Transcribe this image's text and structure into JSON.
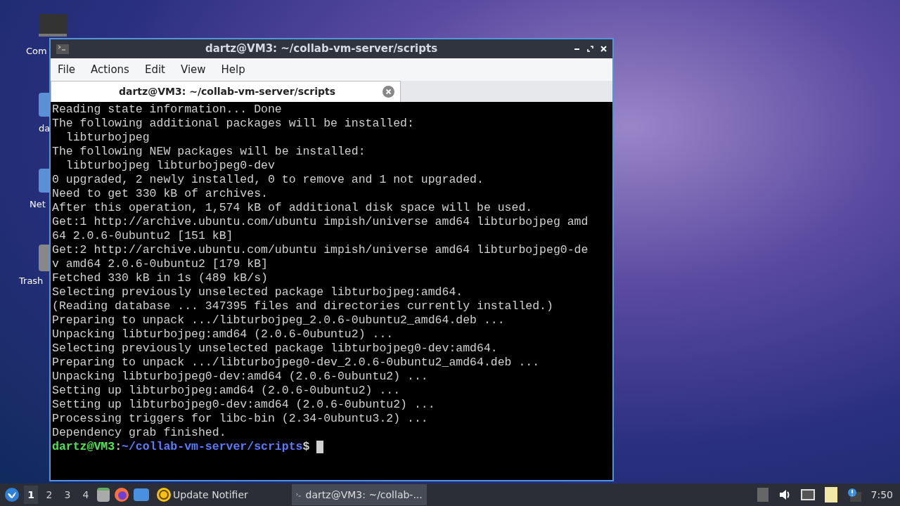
{
  "desktop_icons": [
    {
      "label": "Com",
      "kind": "computer"
    },
    {
      "label": "da",
      "kind": "folder"
    },
    {
      "label": "Net",
      "kind": "folder"
    },
    {
      "label": "Trash",
      "kind": "trash"
    }
  ],
  "window": {
    "title": "dartz@VM3: ~/collab-vm-server/scripts"
  },
  "menu": [
    "File",
    "Actions",
    "Edit",
    "View",
    "Help"
  ],
  "tabs": [
    {
      "label": "dartz@VM3: ~/collab-vm-server/scripts",
      "selected": true
    }
  ],
  "terminal": {
    "lines": [
      "Reading state information... Done",
      "The following additional packages will be installed:",
      "  libturbojpeg",
      "The following NEW packages will be installed:",
      "  libturbojpeg libturbojpeg0-dev",
      "0 upgraded, 2 newly installed, 0 to remove and 1 not upgraded.",
      "Need to get 330 kB of archives.",
      "After this operation, 1,574 kB of additional disk space will be used.",
      "Get:1 http://archive.ubuntu.com/ubuntu impish/universe amd64 libturbojpeg amd",
      "64 2.0.6-0ubuntu2 [151 kB]",
      "Get:2 http://archive.ubuntu.com/ubuntu impish/universe amd64 libturbojpeg0-de",
      "v amd64 2.0.6-0ubuntu2 [179 kB]",
      "Fetched 330 kB in 1s (489 kB/s)",
      "Selecting previously unselected package libturbojpeg:amd64.",
      "(Reading database ... 347395 files and directories currently installed.)",
      "Preparing to unpack .../libturbojpeg_2.0.6-0ubuntu2_amd64.deb ...",
      "Unpacking libturbojpeg:amd64 (2.0.6-0ubuntu2) ...",
      "Selecting previously unselected package libturbojpeg0-dev:amd64.",
      "Preparing to unpack .../libturbojpeg0-dev_2.0.6-0ubuntu2_amd64.deb ...",
      "Unpacking libturbojpeg0-dev:amd64 (2.0.6-0ubuntu2) ...",
      "Setting up libturbojpeg:amd64 (2.0.6-0ubuntu2) ...",
      "Setting up libturbojpeg0-dev:amd64 (2.0.6-0ubuntu2) ...",
      "Processing triggers for libc-bin (2.34-0ubuntu3.2) ...",
      "Dependency grab finished."
    ],
    "prompt": {
      "user_host": "dartz@VM3",
      "separator": ":",
      "path": "~/collab-vm-server/scripts",
      "symbol": "$"
    }
  },
  "taskbar": {
    "workspaces": [
      {
        "label": "1",
        "selected": true
      },
      {
        "label": "2",
        "selected": false
      },
      {
        "label": "3",
        "selected": false
      },
      {
        "label": "4",
        "selected": false
      }
    ],
    "update_notifier": "Update Notifier",
    "tasks": [
      {
        "label": "dartz@VM3: ~/collab-...",
        "selected": true
      }
    ],
    "clock": "7:50"
  }
}
